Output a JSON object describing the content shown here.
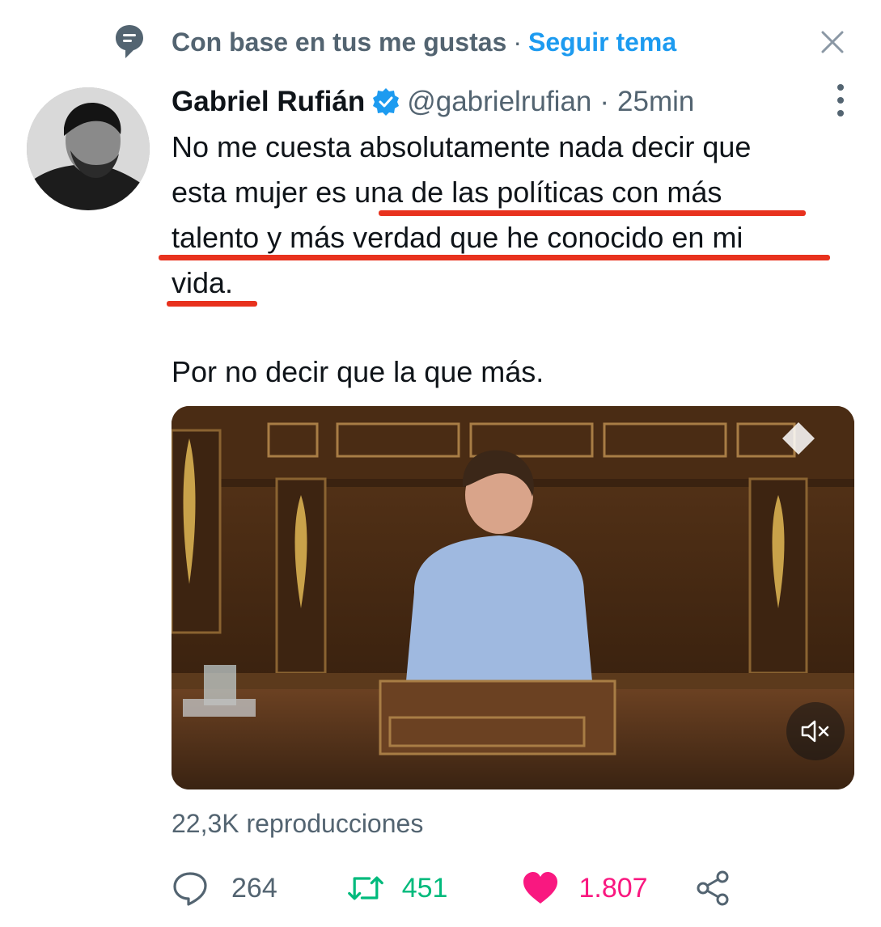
{
  "topic": {
    "context_text": "Con base en tus me gustas",
    "separator": "·",
    "follow_label": "Seguir tema"
  },
  "tweet": {
    "author_name": "Gabriel Rufián",
    "handle": "@gabrielrufian",
    "separator": "·",
    "time": "25min",
    "text_lines": [
      "No me cuesta absolutamente nada decir que",
      "esta mujer es una de las políticas con más",
      "talento y más verdad que he conocido en mi",
      "vida.",
      "Por no decir que la que más."
    ],
    "views": "22,3K reproducciones"
  },
  "actions": {
    "replies": "264",
    "retweets": "451",
    "likes": "1.807"
  },
  "colors": {
    "accent": "#1d9bf0",
    "secondary_text": "#536471",
    "retweet": "#00ba7c",
    "like": "#f91880",
    "annotation_underline": "#e8321e"
  },
  "icons": [
    "topic-icon",
    "close-icon",
    "verified-icon",
    "more-icon",
    "mute-icon",
    "reply-icon",
    "retweet-icon",
    "like-icon",
    "share-icon"
  ]
}
